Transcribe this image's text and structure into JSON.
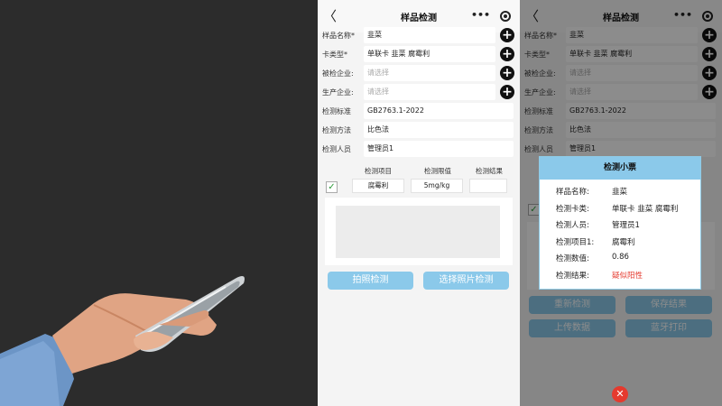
{
  "screen1": {
    "nav": {
      "title": "样品检测",
      "back_glyph": "〈",
      "more_glyph": "•••"
    },
    "fields": [
      {
        "label": "样品名称*",
        "value": "韭菜",
        "placeholder": false,
        "has_plus": true
      },
      {
        "label": "卡类型*",
        "value": "单联卡    韭菜  腐霉利",
        "placeholder": false,
        "has_plus": true
      },
      {
        "label": "被检企业:",
        "value": "请选择",
        "placeholder": true,
        "has_plus": true
      },
      {
        "label": "生产企业:",
        "value": "请选择",
        "placeholder": true,
        "has_plus": true
      },
      {
        "label": "检测标准",
        "value": "GB2763.1-2022",
        "placeholder": false,
        "has_plus": false
      },
      {
        "label": "检测方法",
        "value": "比色法",
        "placeholder": false,
        "has_plus": false
      },
      {
        "label": "检测人员",
        "value": "管理员1",
        "placeholder": false,
        "has_plus": false
      }
    ],
    "table": {
      "headers": [
        "检测项目",
        "检测限值",
        "检测结果"
      ],
      "row": {
        "checked": true,
        "item": "腐霉利",
        "limit": "5mg/kg",
        "result": ""
      }
    },
    "buttons": {
      "photo_detect": "拍照检测",
      "choose_photo_detect": "选择照片检测"
    }
  },
  "screen2": {
    "nav": {
      "title": "样品检测",
      "back_glyph": "〈",
      "more_glyph": "•••"
    },
    "fields": [
      {
        "label": "样品名称*",
        "value": "韭菜",
        "placeholder": false,
        "has_plus": true
      },
      {
        "label": "卡类型*",
        "value": "单联卡    韭菜  腐霉利",
        "placeholder": false,
        "has_plus": true
      },
      {
        "label": "被检企业:",
        "value": "请选择",
        "placeholder": true,
        "has_plus": true
      },
      {
        "label": "生产企业:",
        "value": "请选择",
        "placeholder": true,
        "has_plus": true
      },
      {
        "label": "检测标准",
        "value": "GB2763.1-2022",
        "placeholder": false,
        "has_plus": false
      },
      {
        "label": "检测方法",
        "value": "比色法",
        "placeholder": false,
        "has_plus": false
      },
      {
        "label": "检测人员",
        "value": "管理员1",
        "placeholder": false,
        "has_plus": false
      }
    ],
    "modal": {
      "title": "检测小票",
      "rows": [
        {
          "key": "样品名称:",
          "value": "韭菜",
          "red": false
        },
        {
          "key": "检测卡类:",
          "value": "单联卡 韭菜 腐霉利",
          "red": false
        },
        {
          "key": "检测人员:",
          "value": "管理员1",
          "red": false
        },
        {
          "key": "检测项目1:",
          "value": "腐霉利",
          "red": false
        },
        {
          "key": "检测数值:",
          "value": "0.86",
          "red": false
        },
        {
          "key": "检测结果:",
          "value": "疑似阳性",
          "red": true
        }
      ]
    },
    "buttons": {
      "retest": "重新检测",
      "save_result": "保存结果",
      "upload": "上传数据",
      "bluetooth_print": "蓝牙打印"
    },
    "close_glyph": "✕"
  },
  "colors": {
    "accent": "#8bc9ea",
    "danger": "#e53a2e",
    "check": "#2e9d3b"
  },
  "icons": [
    "back-icon",
    "more-icon",
    "target-icon",
    "plus-icon",
    "check-icon",
    "close-icon"
  ]
}
